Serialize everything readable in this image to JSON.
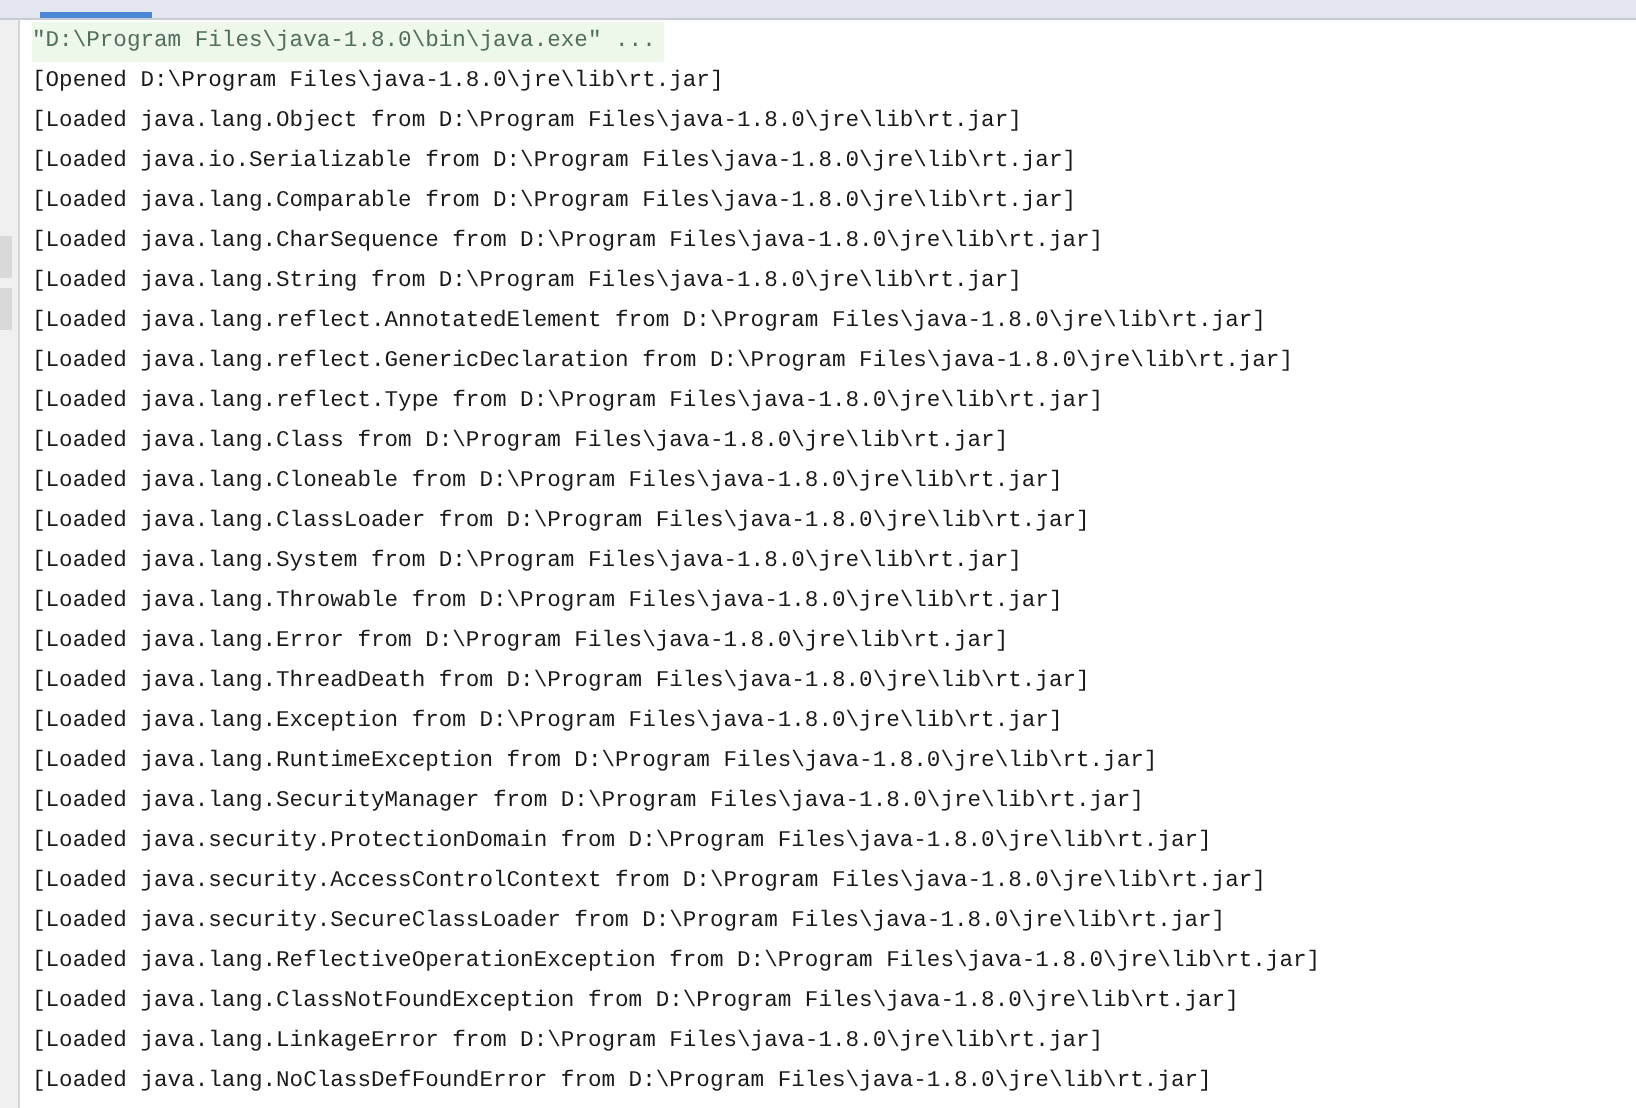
{
  "command": "\"D:\\Program Files\\java-1.8.0\\bin\\java.exe\" ...",
  "lines": [
    "[Opened D:\\Program Files\\java-1.8.0\\jre\\lib\\rt.jar]",
    "[Loaded java.lang.Object from D:\\Program Files\\java-1.8.0\\jre\\lib\\rt.jar]",
    "[Loaded java.io.Serializable from D:\\Program Files\\java-1.8.0\\jre\\lib\\rt.jar]",
    "[Loaded java.lang.Comparable from D:\\Program Files\\java-1.8.0\\jre\\lib\\rt.jar]",
    "[Loaded java.lang.CharSequence from D:\\Program Files\\java-1.8.0\\jre\\lib\\rt.jar]",
    "[Loaded java.lang.String from D:\\Program Files\\java-1.8.0\\jre\\lib\\rt.jar]",
    "[Loaded java.lang.reflect.AnnotatedElement from D:\\Program Files\\java-1.8.0\\jre\\lib\\rt.jar]",
    "[Loaded java.lang.reflect.GenericDeclaration from D:\\Program Files\\java-1.8.0\\jre\\lib\\rt.jar]",
    "[Loaded java.lang.reflect.Type from D:\\Program Files\\java-1.8.0\\jre\\lib\\rt.jar]",
    "[Loaded java.lang.Class from D:\\Program Files\\java-1.8.0\\jre\\lib\\rt.jar]",
    "[Loaded java.lang.Cloneable from D:\\Program Files\\java-1.8.0\\jre\\lib\\rt.jar]",
    "[Loaded java.lang.ClassLoader from D:\\Program Files\\java-1.8.0\\jre\\lib\\rt.jar]",
    "[Loaded java.lang.System from D:\\Program Files\\java-1.8.0\\jre\\lib\\rt.jar]",
    "[Loaded java.lang.Throwable from D:\\Program Files\\java-1.8.0\\jre\\lib\\rt.jar]",
    "[Loaded java.lang.Error from D:\\Program Files\\java-1.8.0\\jre\\lib\\rt.jar]",
    "[Loaded java.lang.ThreadDeath from D:\\Program Files\\java-1.8.0\\jre\\lib\\rt.jar]",
    "[Loaded java.lang.Exception from D:\\Program Files\\java-1.8.0\\jre\\lib\\rt.jar]",
    "[Loaded java.lang.RuntimeException from D:\\Program Files\\java-1.8.0\\jre\\lib\\rt.jar]",
    "[Loaded java.lang.SecurityManager from D:\\Program Files\\java-1.8.0\\jre\\lib\\rt.jar]",
    "[Loaded java.security.ProtectionDomain from D:\\Program Files\\java-1.8.0\\jre\\lib\\rt.jar]",
    "[Loaded java.security.AccessControlContext from D:\\Program Files\\java-1.8.0\\jre\\lib\\rt.jar]",
    "[Loaded java.security.SecureClassLoader from D:\\Program Files\\java-1.8.0\\jre\\lib\\rt.jar]",
    "[Loaded java.lang.ReflectiveOperationException from D:\\Program Files\\java-1.8.0\\jre\\lib\\rt.jar]",
    "[Loaded java.lang.ClassNotFoundException from D:\\Program Files\\java-1.8.0\\jre\\lib\\rt.jar]",
    "[Loaded java.lang.LinkageError from D:\\Program Files\\java-1.8.0\\jre\\lib\\rt.jar]",
    "[Loaded java.lang.NoClassDefFoundError from D:\\Program Files\\java-1.8.0\\jre\\lib\\rt.jar]"
  ]
}
